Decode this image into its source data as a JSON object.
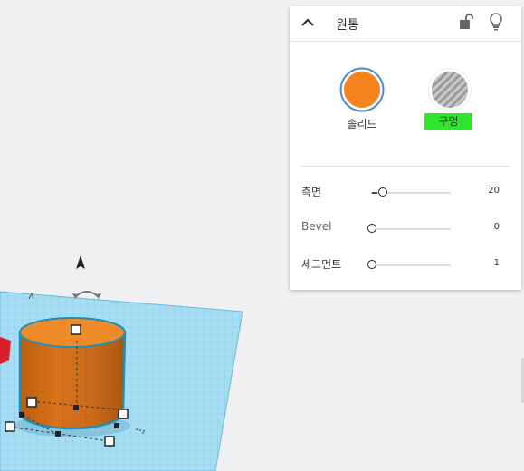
{
  "panel": {
    "title": "원통",
    "icons": {
      "collapse": "chevron-up-icon",
      "lock": "unlocked-icon",
      "bulb": "lightbulb-icon"
    },
    "solid_label": "솔리드",
    "hole_label": "구멍",
    "colors": {
      "solid": "#f5841f",
      "hole_badge": "#2ee62e",
      "shape_orange": "#e07a1a",
      "grid": "#8fd3ee"
    },
    "props": [
      {
        "label": "측면",
        "value": "20"
      },
      {
        "label": "Bevel",
        "value": "0"
      },
      {
        "label": "세그먼트",
        "value": "1"
      }
    ]
  },
  "slider_levels": [
    0.14,
    0.0,
    0.0
  ]
}
